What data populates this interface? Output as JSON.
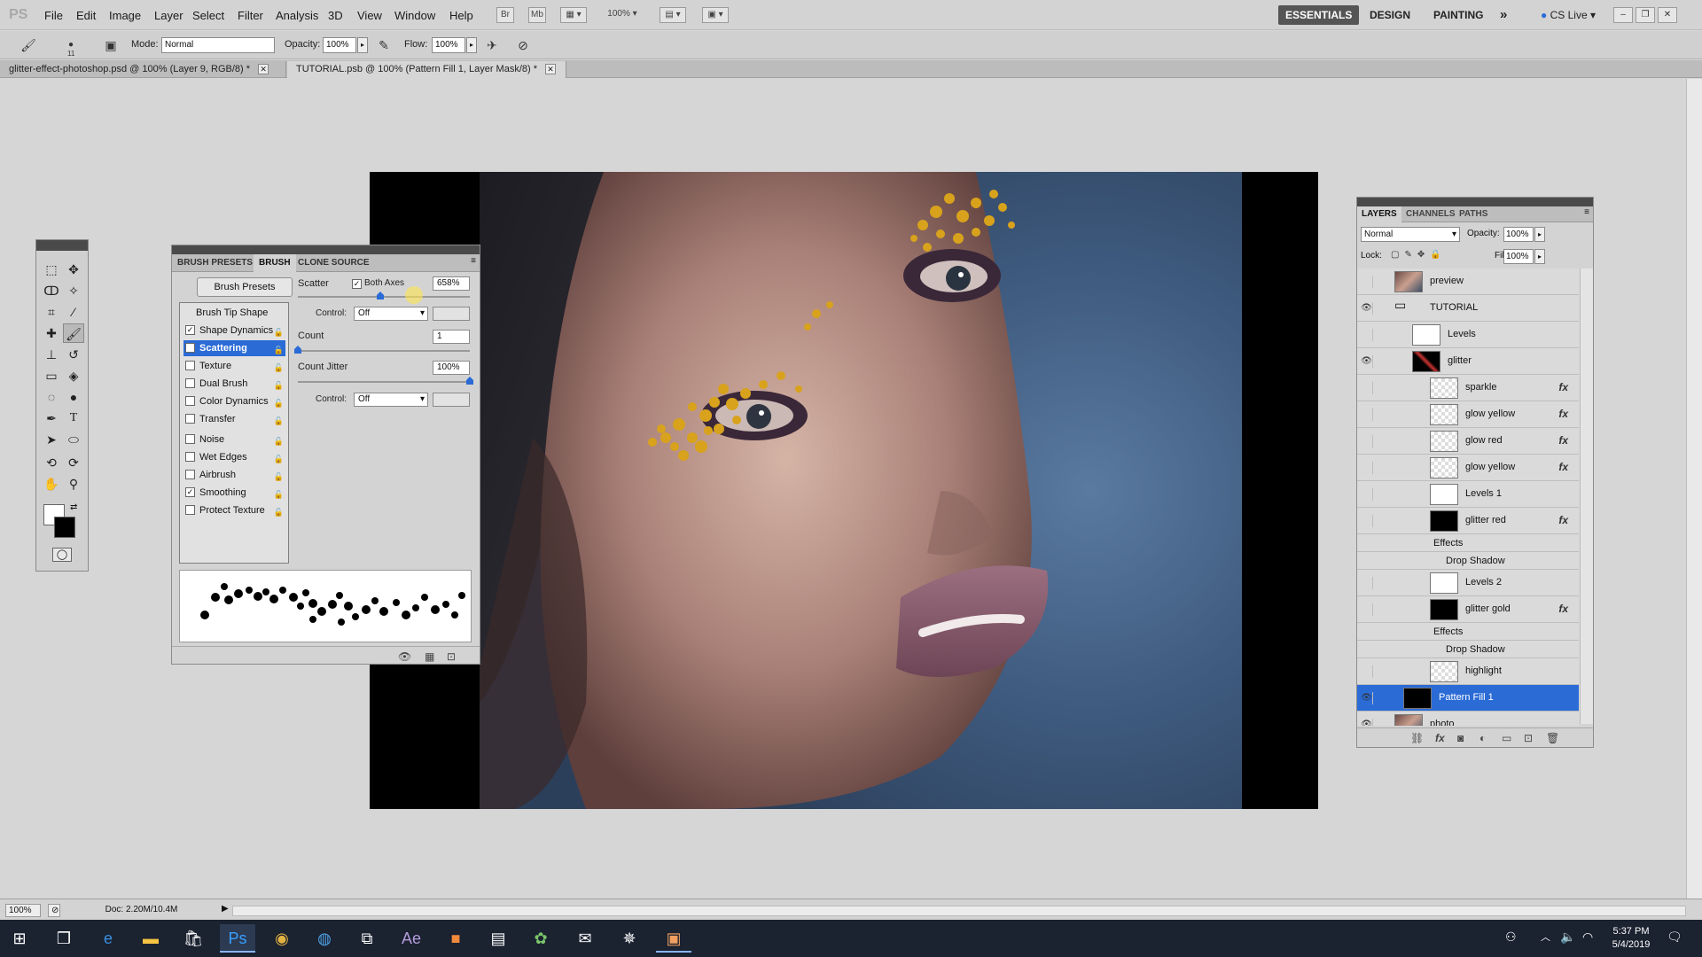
{
  "app": {
    "logo": "PS"
  },
  "menu": [
    "File",
    "Edit",
    "Image",
    "Layer",
    "Select",
    "Filter",
    "Analysis",
    "3D",
    "View",
    "Window",
    "Help"
  ],
  "menubar_buttons": {
    "br": "Br",
    "mb": "Mb",
    "zoom": "100%"
  },
  "workspaces": {
    "essentials": "ESSENTIALS",
    "design": "DESIGN",
    "painting": "PAINTING",
    "more": "»",
    "cslive": "CS Live"
  },
  "options": {
    "mode_label": "Mode:",
    "mode_value": "Normal",
    "opacity_label": "Opacity:",
    "opacity_value": "100%",
    "flow_label": "Flow:",
    "flow_value": "100%",
    "brush_size": "11"
  },
  "doc_tabs": [
    {
      "label": "glitter-effect-photoshop.psd @ 100% (Layer 9, RGB/8) *"
    },
    {
      "label": "TUTORIAL.psb @ 100% (Pattern Fill 1, Layer Mask/8) *"
    }
  ],
  "brush_panel": {
    "tabs": [
      "BRUSH PRESETS",
      "BRUSH",
      "CLONE SOURCE"
    ],
    "presets_button": "Brush Presets",
    "list_header": "Brush Tip Shape",
    "items": [
      {
        "label": "Shape Dynamics",
        "checked": true
      },
      {
        "label": "Scattering",
        "checked": true,
        "selected": true
      },
      {
        "label": "Texture",
        "checked": false
      },
      {
        "label": "Dual Brush",
        "checked": false
      },
      {
        "label": "Color Dynamics",
        "checked": false
      },
      {
        "label": "Transfer",
        "checked": false
      },
      {
        "label": "Noise",
        "checked": false
      },
      {
        "label": "Wet Edges",
        "checked": false
      },
      {
        "label": "Airbrush",
        "checked": false
      },
      {
        "label": "Smoothing",
        "checked": true
      },
      {
        "label": "Protect Texture",
        "checked": false
      }
    ],
    "scatter_label": "Scatter",
    "both_axes_label": "Both Axes",
    "scatter_value": "658%",
    "control_label": "Control:",
    "control_value": "Off",
    "count_label": "Count",
    "count_value": "1",
    "count_jitter_label": "Count Jitter",
    "count_jitter_value": "100%",
    "control2_label": "Control:",
    "control2_value": "Off",
    "scatter_level": 0.658,
    "count_level": 0.0,
    "count_jitter_level": 1.0
  },
  "layers_panel": {
    "tabs": [
      "LAYERS",
      "CHANNELS",
      "PATHS"
    ],
    "blend_mode": "Normal",
    "opacity_label": "Opacity:",
    "opacity_value": "100%",
    "lock_label": "Lock:",
    "fill_label": "Fill:",
    "fill_value": "100%",
    "layers": [
      {
        "name": "preview",
        "visible": false,
        "thumb": "photo"
      },
      {
        "name": "TUTORIAL",
        "visible": true,
        "thumb": "folder"
      },
      {
        "name": "Levels",
        "visible": false,
        "thumb": "white"
      },
      {
        "name": "glitter",
        "visible": true,
        "thumb": "folder-mask"
      },
      {
        "name": "sparkle",
        "visible": false,
        "thumb": "checker",
        "fx": "fx"
      },
      {
        "name": "glow yellow",
        "visible": false,
        "thumb": "checker",
        "fx": "fx"
      },
      {
        "name": "glow red",
        "visible": false,
        "thumb": "checker",
        "fx": "fx"
      },
      {
        "name": "glow yellow",
        "visible": false,
        "thumb": "checker",
        "fx": "fx"
      },
      {
        "name": "Levels 1",
        "visible": false,
        "thumb": "white"
      },
      {
        "name": "glitter red",
        "visible": false,
        "thumb": "black",
        "fx": "fx"
      },
      {
        "name": "Effects",
        "sub": true
      },
      {
        "name": "Drop Shadow",
        "sub": true
      },
      {
        "name": "Levels 2",
        "visible": false,
        "thumb": "white"
      },
      {
        "name": "glitter gold",
        "visible": false,
        "thumb": "black",
        "fx": "fx"
      },
      {
        "name": "Effects",
        "sub": true
      },
      {
        "name": "Drop Shadow",
        "sub": true
      },
      {
        "name": "highlight",
        "visible": false,
        "thumb": "checker"
      },
      {
        "name": "Pattern Fill 1",
        "visible": true,
        "thumb": "black",
        "selected": true
      },
      {
        "name": "photo",
        "visible": true,
        "thumb": "photo"
      }
    ]
  },
  "status": {
    "zoom": "100%",
    "doc": "Doc: 2.20M/10.4M"
  },
  "taskbar": {
    "time": "5:37 PM",
    "date": "5/4/2019"
  }
}
